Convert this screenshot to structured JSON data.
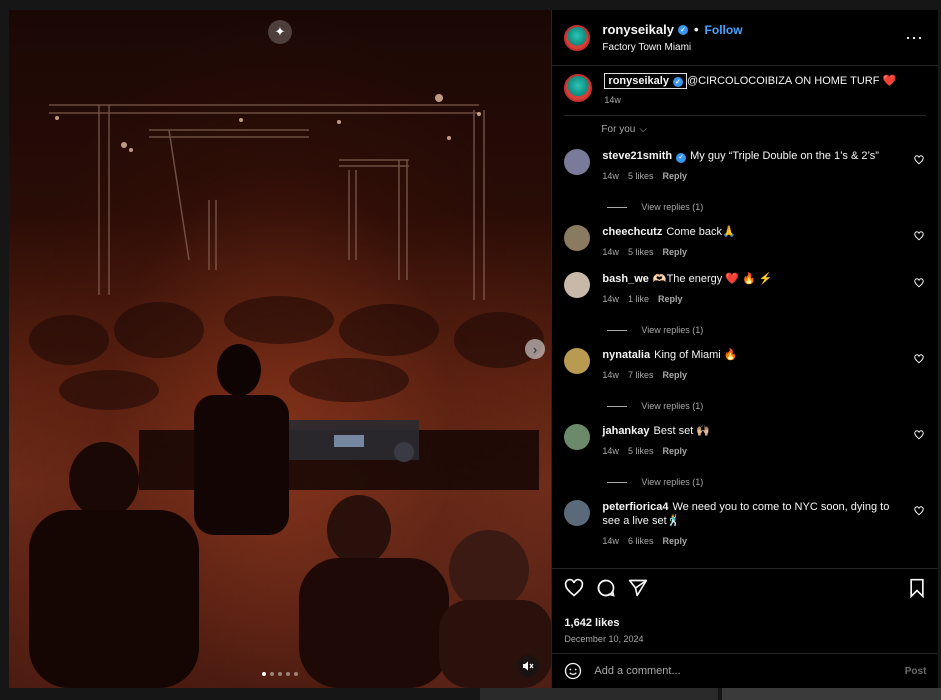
{
  "post": {
    "username": "ronyseikaly",
    "verified": true,
    "follow_label": "Follow",
    "dot": "•",
    "location": "Factory Town Miami",
    "more_icon": "⋯"
  },
  "caption": {
    "username": "ronyseikaly",
    "text": "@CIRCOLOCOIBIZA ON HOME TURF ❤️",
    "time": "14w"
  },
  "sort_label": "For you",
  "comments": [
    {
      "username": "steve21smith",
      "verified": true,
      "text": "My guy “Triple Double on the 1’s & 2’s”",
      "time": "14w",
      "likes": "5 likes",
      "reply": "Reply",
      "view_replies": "View replies (1)",
      "avatar_color": "#7a7a9a"
    },
    {
      "username": "cheechcutz",
      "verified": false,
      "text": "Come back🙏",
      "time": "14w",
      "likes": "5 likes",
      "reply": "Reply",
      "view_replies": "",
      "avatar_color": "#8a7a60"
    },
    {
      "username": "bash_we",
      "verified": false,
      "text": "🫶🏻The energy ❤️ 🔥 ⚡",
      "time": "14w",
      "likes": "1 like",
      "reply": "Reply",
      "view_replies": "View replies (1)",
      "avatar_color": "#c8b8a8"
    },
    {
      "username": "nynatalia",
      "verified": false,
      "text": "King of Miami 🔥",
      "time": "14w",
      "likes": "7 likes",
      "reply": "Reply",
      "view_replies": "View replies (1)",
      "avatar_color": "#b89a50"
    },
    {
      "username": "jahankay",
      "verified": false,
      "text": "Best set 🙌🏼",
      "time": "14w",
      "likes": "5 likes",
      "reply": "Reply",
      "view_replies": "View replies (1)",
      "avatar_color": "#6a8a6a"
    },
    {
      "username": "peterfiorica4",
      "verified": false,
      "text": "We need you to come to NYC soon, dying to see a live set🕺",
      "time": "14w",
      "likes": "6 likes",
      "reply": "Reply",
      "view_replies": "",
      "avatar_color": "#5a6a7a"
    }
  ],
  "stats": {
    "likes": "1,642 likes",
    "date": "December 10, 2024"
  },
  "composer": {
    "placeholder": "Add a comment...",
    "post_label": "Post"
  },
  "media": {
    "carousel_count": 5,
    "active_index": 0,
    "ai_icon": "✦",
    "next_icon": "›"
  },
  "colors": {
    "accent": "#4aa3ff",
    "verified": "#3897f0",
    "muted_text": "#a8a8a8"
  }
}
